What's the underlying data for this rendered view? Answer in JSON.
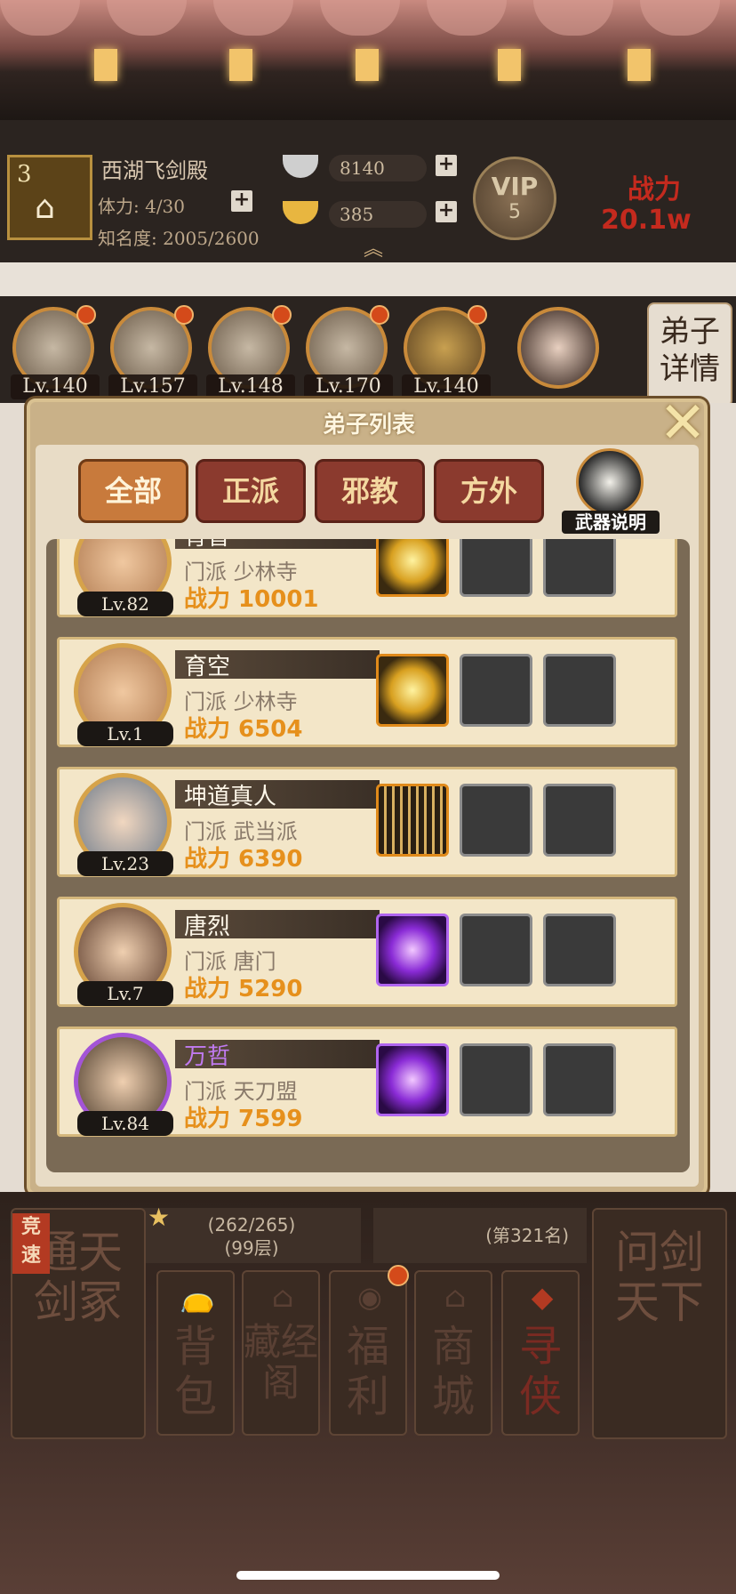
{
  "header": {
    "level": "3",
    "player_name": "西湖飞剑殿",
    "stamina": "体力: 4/30",
    "fame": "知名度: 2005/2600",
    "silver": "8140",
    "gold": "385",
    "vip_label": "VIP",
    "vip_level": "5",
    "power_label": "战力",
    "power_value": "20.1w",
    "plus": "+",
    "expand": "︽"
  },
  "heroes": [
    {
      "level": "Lv.140"
    },
    {
      "level": "Lv.157"
    },
    {
      "level": "Lv.148"
    },
    {
      "level": "Lv.170"
    },
    {
      "level": "Lv.140"
    },
    {
      "level": ""
    }
  ],
  "detail_tab": "弟子详情",
  "dialog": {
    "title": "弟子列表",
    "close": "✕",
    "tabs": [
      "全部",
      "正派",
      "邪教",
      "方外"
    ],
    "weapon_help": "武器说明"
  },
  "disciples": [
    {
      "name": "育智",
      "sect": "门派  少林寺",
      "power": "战力 10001",
      "level": "Lv.82",
      "weapon": "gold"
    },
    {
      "name": "育空",
      "sect": "门派  少林寺",
      "power": "战力 6504",
      "level": "Lv.1",
      "weapon": "gold"
    },
    {
      "name": "坤道真人",
      "sect": "门派  武当派",
      "power": "战力 6390",
      "level": "Lv.23",
      "weapon": "scroll"
    },
    {
      "name": "唐烈",
      "sect": "门派  唐门",
      "power": "战力 5290",
      "level": "Lv.7",
      "weapon": "violet"
    },
    {
      "name": "万哲",
      "sect": "门派  天刀盟",
      "power": "战力 7599",
      "level": "Lv.84",
      "weapon": "violet"
    }
  ],
  "bottom": {
    "tower_progress": "(262/265)",
    "tower_floor": "(99层)",
    "rank": "(第321名)",
    "compete_badge": "竞速",
    "left_panel": "通天剑冢",
    "right_panel": "问剑天下",
    "nav": [
      {
        "label": "背包",
        "icon": "bag-icon",
        "glyph": "👝"
      },
      {
        "label": "藏经阁",
        "icon": "pavilion-icon",
        "glyph": "⌂"
      },
      {
        "label": "福利",
        "icon": "gift-icon",
        "glyph": "◉"
      },
      {
        "label": "商城",
        "icon": "shop-icon",
        "glyph": "⌂"
      },
      {
        "label": "寻侠",
        "icon": "seek-icon",
        "glyph": "◆"
      }
    ]
  }
}
